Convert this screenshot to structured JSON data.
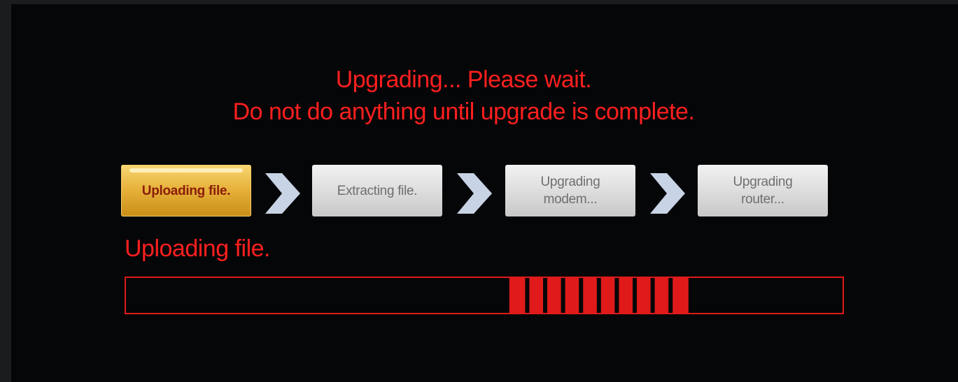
{
  "warning": {
    "line1": "Upgrading... Please wait.",
    "line2": "Do not do anything until upgrade is complete."
  },
  "steps": [
    {
      "label": "Uploading file.",
      "state": "active"
    },
    {
      "label": "Extracting file.",
      "state": "pending"
    },
    {
      "label": "Upgrading\nmodem...",
      "state": "pending"
    },
    {
      "label": "Upgrading\nrouter...",
      "state": "pending"
    }
  ],
  "status_text": "Uploading file.",
  "progress": {
    "style": "indeterminate-stripes",
    "segment_start_fraction": 0.535,
    "segment_end_fraction": 0.785,
    "stripe_count": 10
  },
  "colors": {
    "accent_red": "#ff1f1f",
    "bar_red": "#e01a1a",
    "active_step": "#e8b33c",
    "idle_step": "#d9d9d9",
    "arrow": "#c9d3e6"
  },
  "icons": {
    "step_separator": "chevron-right-icon"
  }
}
